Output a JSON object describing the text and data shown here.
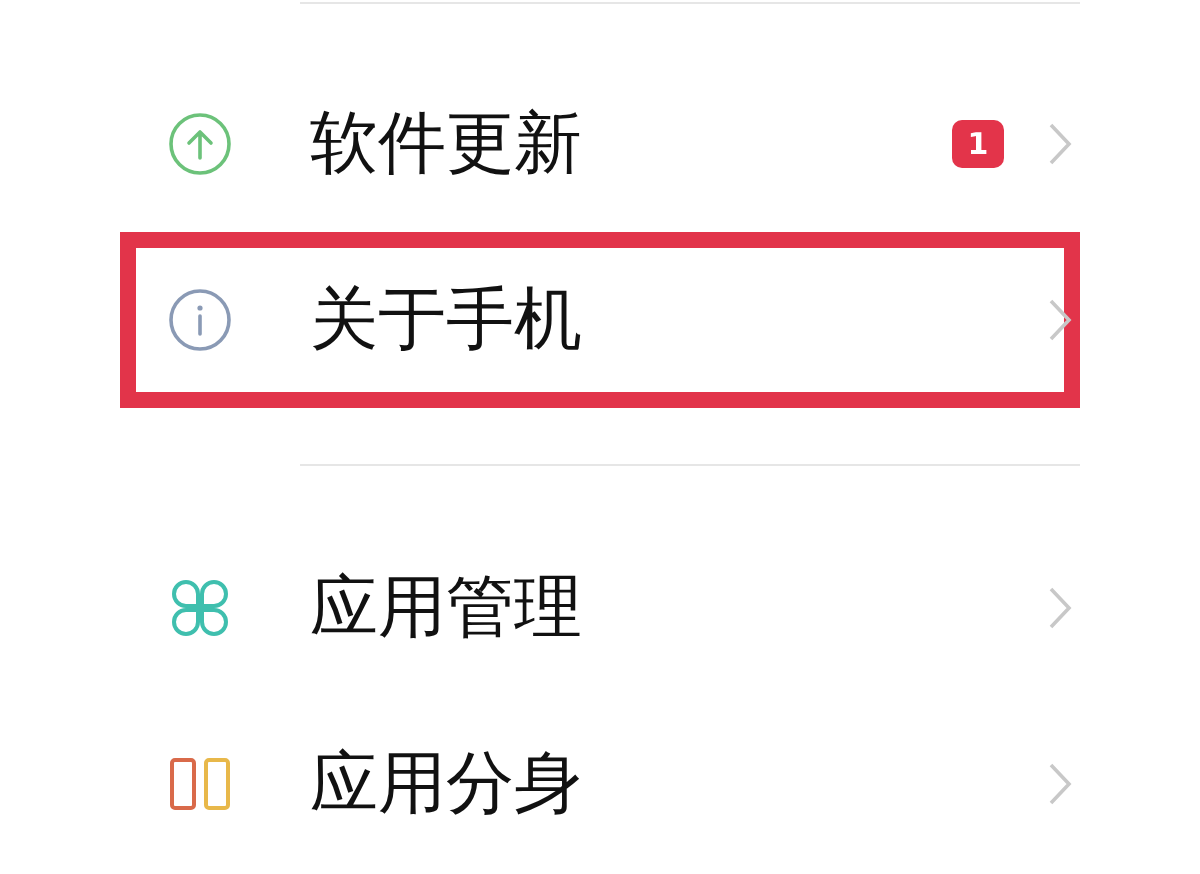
{
  "groups": [
    {
      "rows": [
        {
          "label": "软件更新",
          "badge": "1",
          "highlighted": false
        },
        {
          "label": "关于手机",
          "highlighted": true
        }
      ]
    },
    {
      "rows": [
        {
          "label": "应用管理",
          "highlighted": false
        },
        {
          "label": "应用分身",
          "highlighted": false
        }
      ]
    }
  ]
}
